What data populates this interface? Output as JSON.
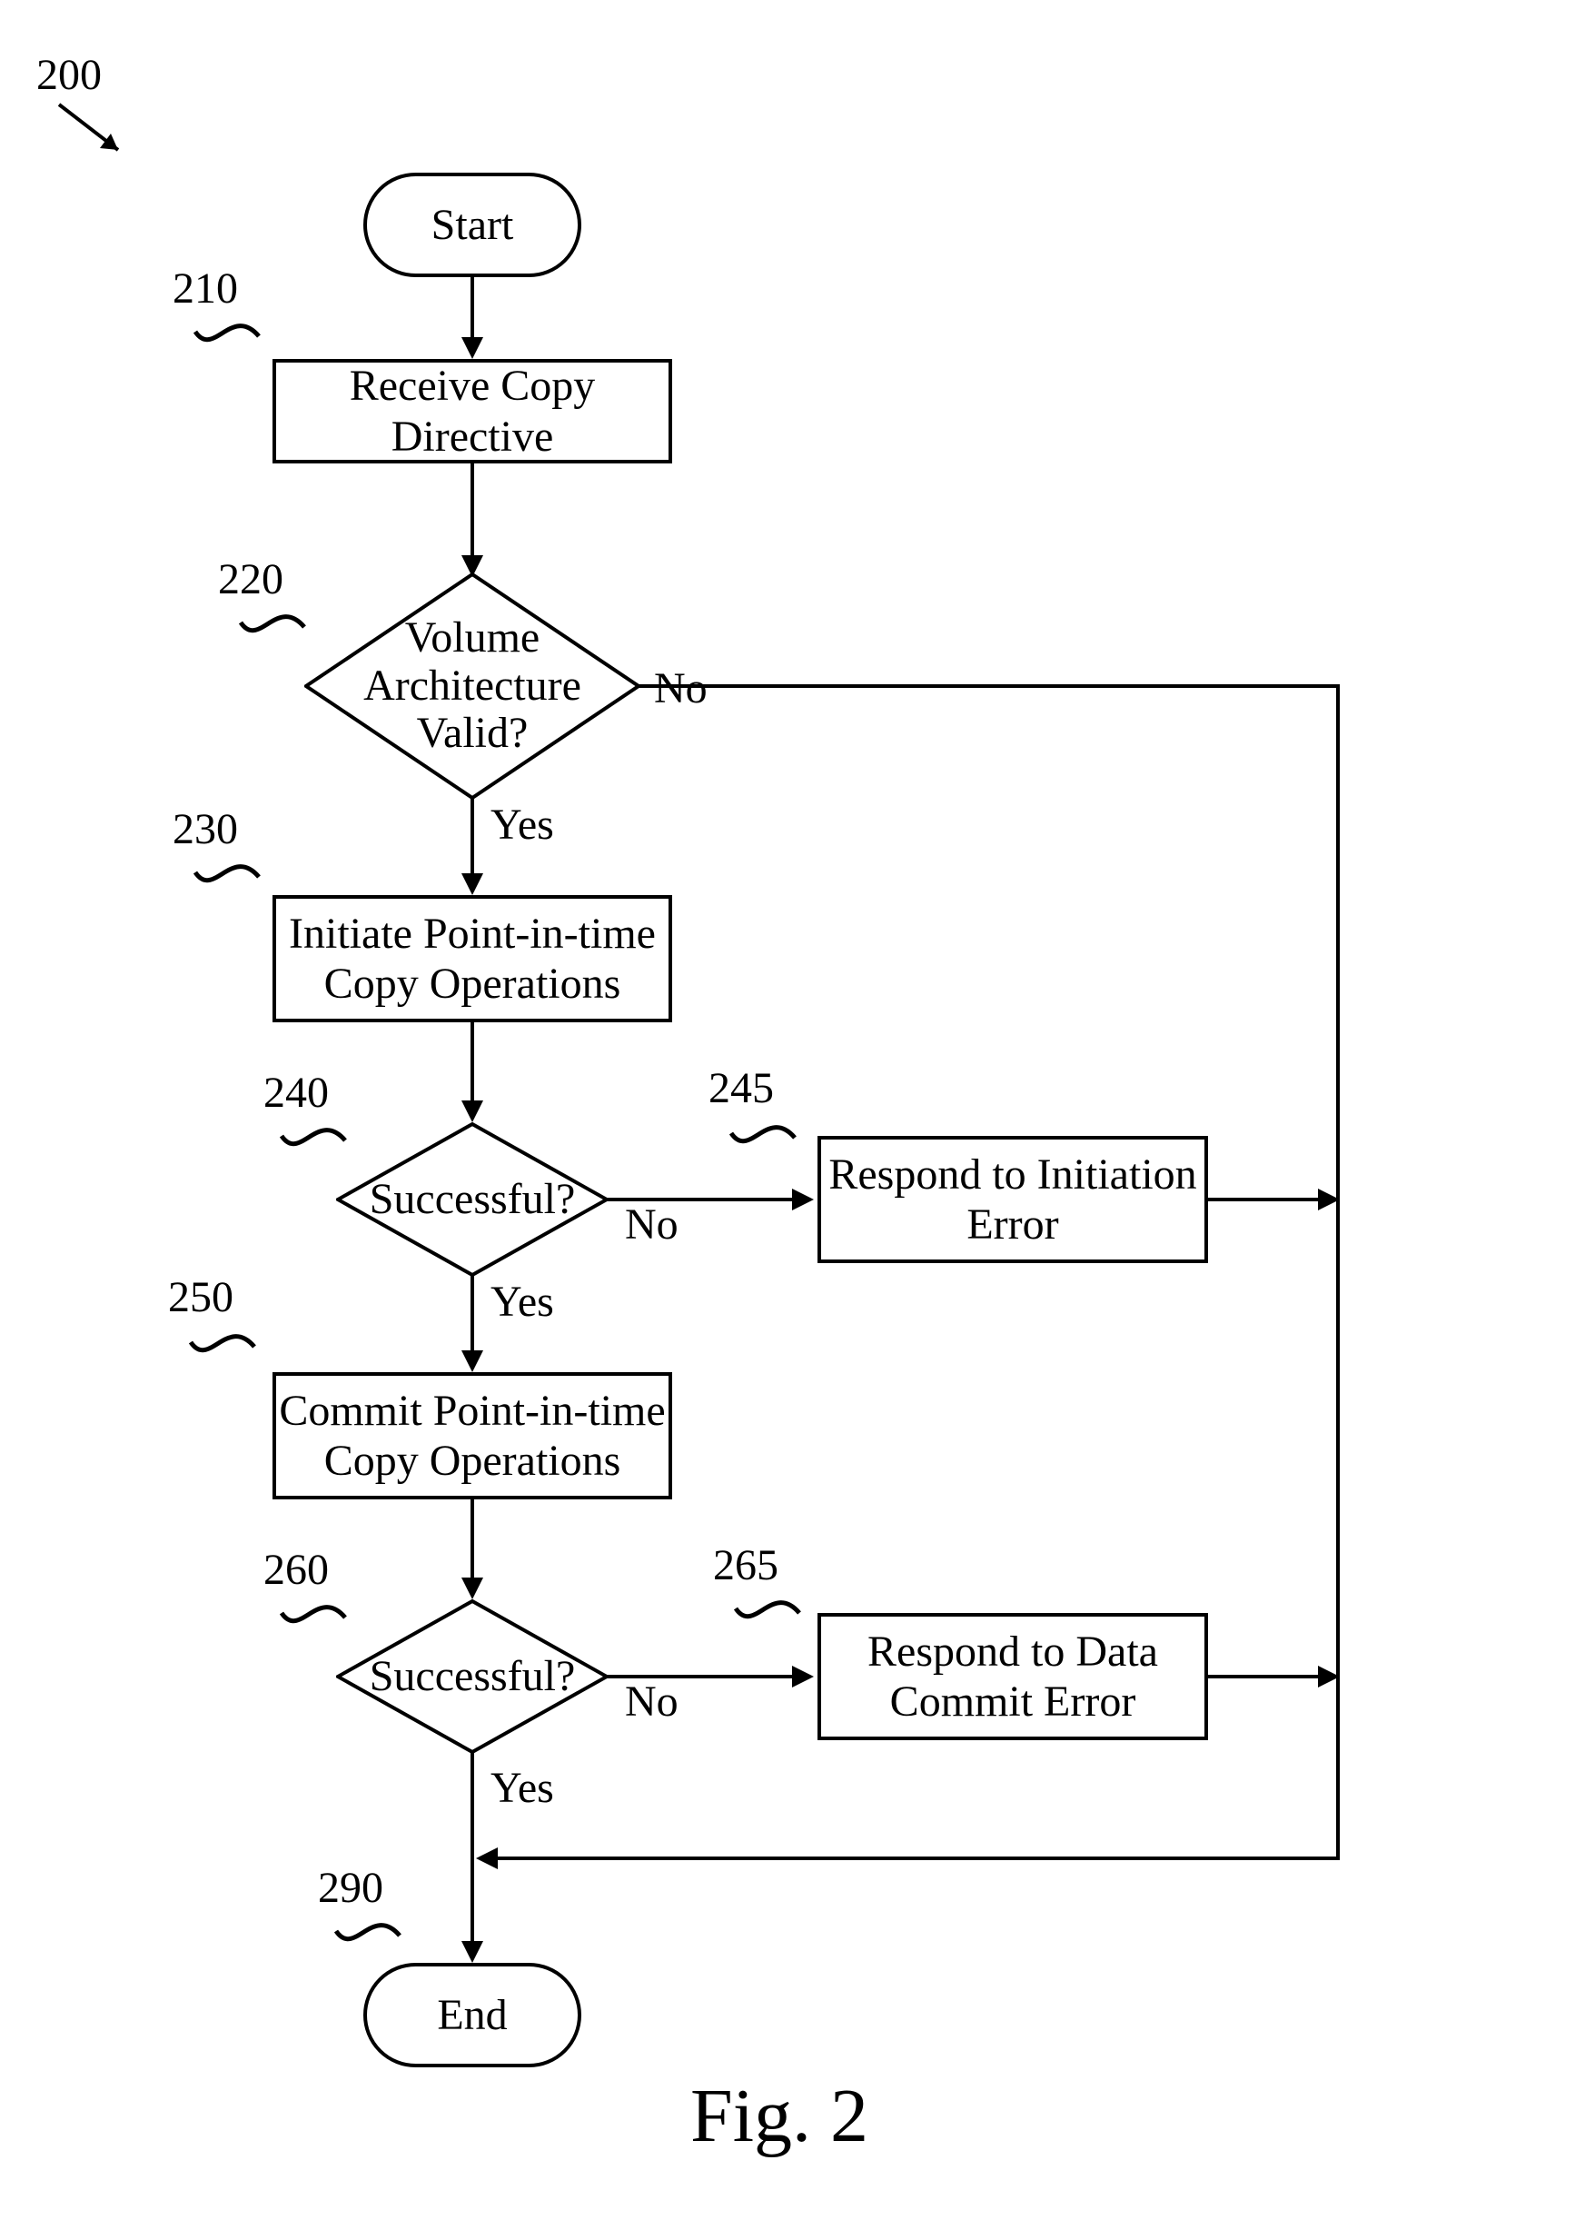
{
  "figure_ref": "200",
  "figure_caption": "Fig. 2",
  "nodes": {
    "start": {
      "ref": "",
      "text": "Start"
    },
    "n210": {
      "ref": "210",
      "text": "Receive Copy Directive"
    },
    "n220": {
      "ref": "220",
      "text": "Volume\nArchitecture\nValid?"
    },
    "n230": {
      "ref": "230",
      "text": "Initiate Point-in-time\nCopy Operations"
    },
    "n240": {
      "ref": "240",
      "text": "Successful?"
    },
    "n245": {
      "ref": "245",
      "text": "Respond to Initiation\nError"
    },
    "n250": {
      "ref": "250",
      "text": "Commit Point-in-time\nCopy Operations"
    },
    "n260": {
      "ref": "260",
      "text": "Successful?"
    },
    "n265": {
      "ref": "265",
      "text": "Respond to Data\nCommit Error"
    },
    "end": {
      "ref": "290",
      "text": "End"
    }
  },
  "edge_labels": {
    "yes": "Yes",
    "no": "No"
  }
}
